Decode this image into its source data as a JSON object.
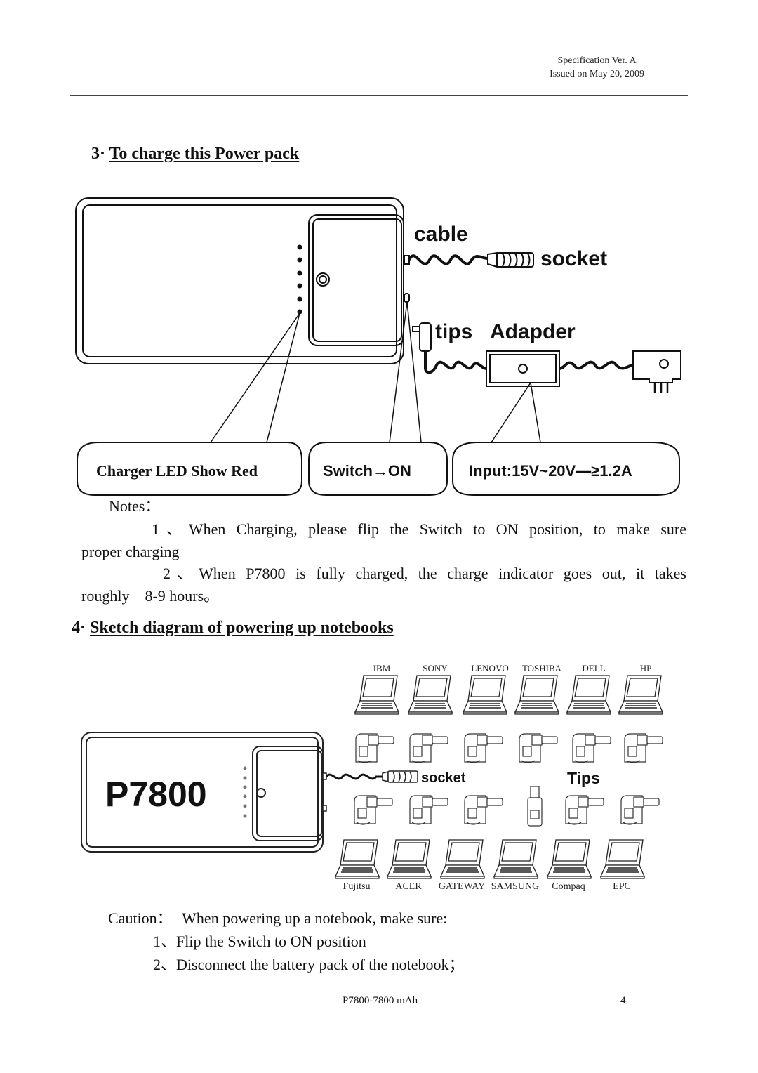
{
  "header": {
    "spec_version": "Specification Ver. A",
    "issued": "Issued on May 20, 2009"
  },
  "section3": {
    "number": "3·",
    "title": "To charge this Power pack",
    "labels": {
      "cable": "cable",
      "socket": "socket",
      "tips": "tips",
      "adapter": "Adapder"
    },
    "callouts": [
      "Charger LED Show Red",
      "Switch→ON",
      "Input:15V~20V—≥1.2A"
    ],
    "led_count": 6,
    "notes_label": "Notes：",
    "notes": [
      {
        "num": "1、",
        "first": "When Charging, please flip the Switch to ON position, to make sure",
        "cont": "proper charging"
      },
      {
        "num": "2、",
        "first": "When P7800 is fully charged, the charge indicator goes out, it takes",
        "cont": "roughly    8-9 hours。"
      }
    ]
  },
  "section4": {
    "number": "4·",
    "title": "Sketch diagram of powering up notebooks",
    "device_label": "P7800",
    "socket_label": "socket",
    "tips_label": "Tips",
    "top_brands": [
      "IBM",
      "SONY",
      "LENOVO",
      "TOSHIBA",
      "DELL",
      "HP"
    ],
    "bottom_brands": [
      "Fujitsu",
      "ACER",
      "GATEWAY",
      "SAMSUNG",
      "Compaq",
      "EPC"
    ],
    "tips_top_count": 6,
    "tips_bottom_count": 6
  },
  "caution": {
    "label": "Caution：",
    "text": "When powering up a notebook, make sure:",
    "items": [
      {
        "num": "1、",
        "text": "Flip the Switch to ON position"
      },
      {
        "num": "2、",
        "text": "Disconnect the battery pack of the notebook；"
      }
    ]
  },
  "footer": {
    "model": "P7800-7800 mAh",
    "page": "4"
  }
}
